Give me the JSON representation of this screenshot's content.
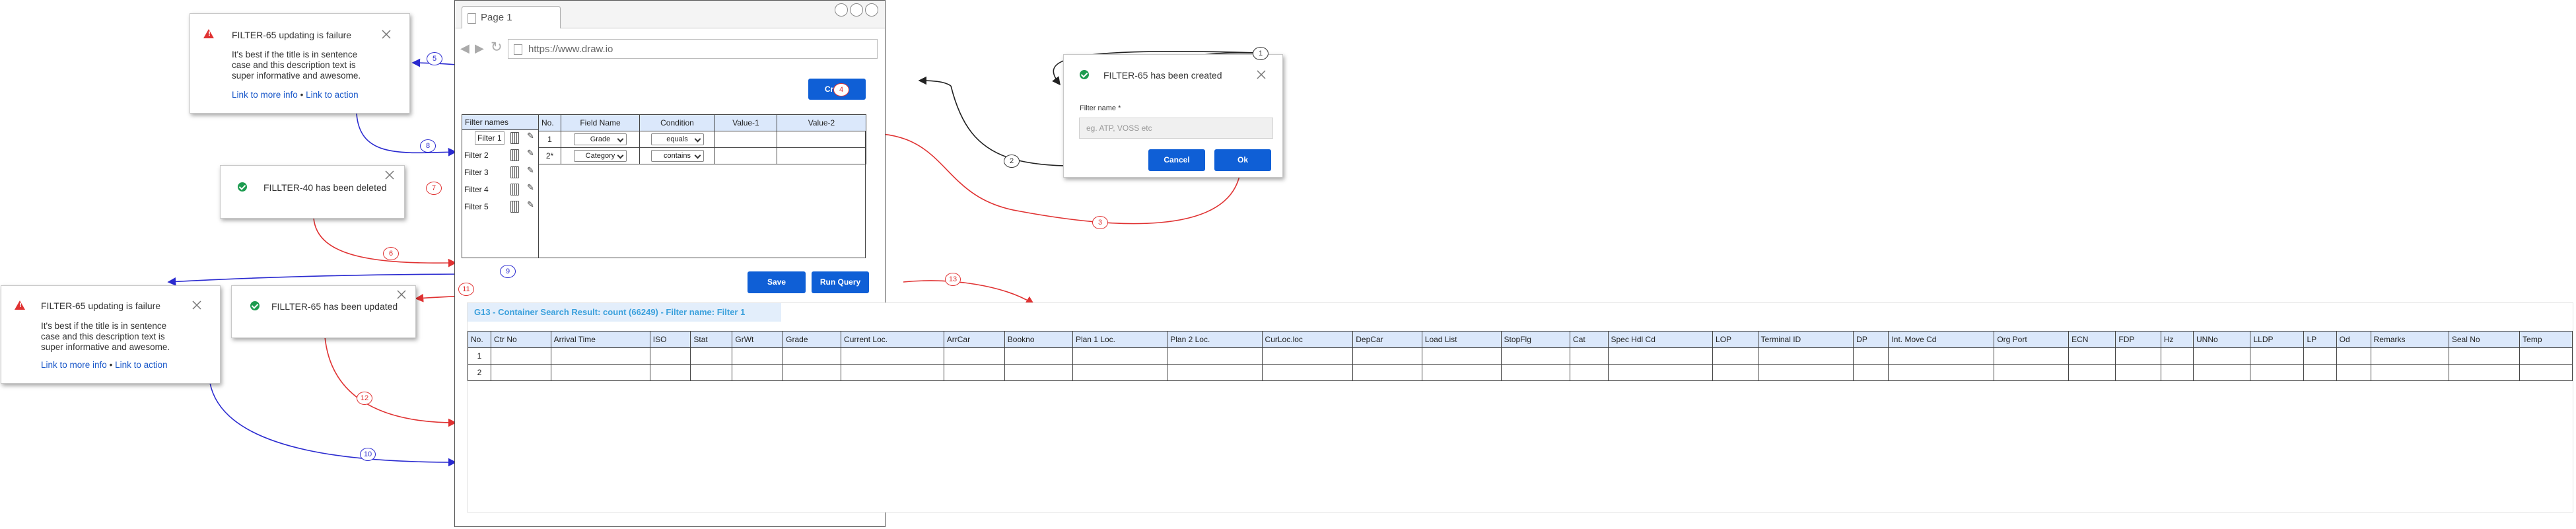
{
  "browser": {
    "tab_label": "Page 1",
    "url": "https://www.draw.io"
  },
  "filter_panel": {
    "create_label": "Create",
    "filter_names_header": "Filter names",
    "filters": [
      "Filter 1",
      "Filter 2",
      "Filter 3",
      "Filter 4",
      "Filter 5"
    ],
    "columns": [
      "No.",
      "Field Name",
      "Condition",
      "Value-1",
      "Value-2"
    ],
    "rows": [
      {
        "no": "1",
        "field": "Grade",
        "condition": "equals",
        "v1": "",
        "v2": ""
      },
      {
        "no": "2*",
        "field": "Category",
        "condition": "contains",
        "v1": "",
        "v2": ""
      }
    ],
    "save_label": "Save",
    "run_query_label": "Run Query"
  },
  "results": {
    "header": "G13 - Container Search Result: count (66249) - Filter name: Filter 1",
    "columns": [
      "No.",
      "Ctr No",
      "Arrival Time",
      "ISO",
      "Stat",
      "GrWt",
      "Grade",
      "Current Loc.",
      "ArrCar",
      "Bookno",
      "Plan 1 Loc.",
      "Plan 2 Loc.",
      "CurLoc.loc",
      "DepCar",
      "Load List",
      "StopFlg",
      "Cat",
      "Spec Hdl Cd",
      "LOP",
      "Terminal ID",
      "DP",
      "Int. Move Cd",
      "Org Port",
      "ECN",
      "FDP",
      "Hz",
      "UNNo",
      "LLDP",
      "LP",
      "Od",
      "Remarks",
      "Seal No",
      "Temp"
    ],
    "rows": [
      "1",
      "2"
    ]
  },
  "dialog": {
    "title": "FILTER-65 has been created",
    "field_label": "Filter name *",
    "placeholder": "eg. ATP, VOSS etc",
    "cancel_label": "Cancel",
    "ok_label": "Ok"
  },
  "toasts": {
    "failure_top": {
      "title": "FILTER-65 updating is failure",
      "body": [
        "It's best if the title is in sentence",
        "case and this description text is",
        "super informative and awesome."
      ],
      "link1": "Link to more info",
      "sep": "•",
      "link2": "Link to action"
    },
    "deleted": {
      "title": "FILLTER-40 has been deleted"
    },
    "failure_bottom": {
      "title": "FILTER-65 updating is failure",
      "body": [
        "It's best if the title is in sentence",
        "case and this description text is",
        "super informative and awesome."
      ],
      "link1": "Link to more info",
      "sep": "•",
      "link2": "Link to action"
    },
    "updated": {
      "title": "FILLTER-65 has been updated"
    }
  },
  "step_labels": [
    "1",
    "2",
    "3",
    "4",
    "5",
    "6",
    "7",
    "8",
    "9",
    "10",
    "11",
    "12",
    "13"
  ],
  "colors": {
    "primary": "#0f5fd6",
    "success": "#1c9b4f",
    "error": "#e03232",
    "flow_blue": "#2a2ad0",
    "header_blue": "#dbe8fb",
    "result_header": "#e3eefb",
    "result_text": "#3aa0dc"
  }
}
